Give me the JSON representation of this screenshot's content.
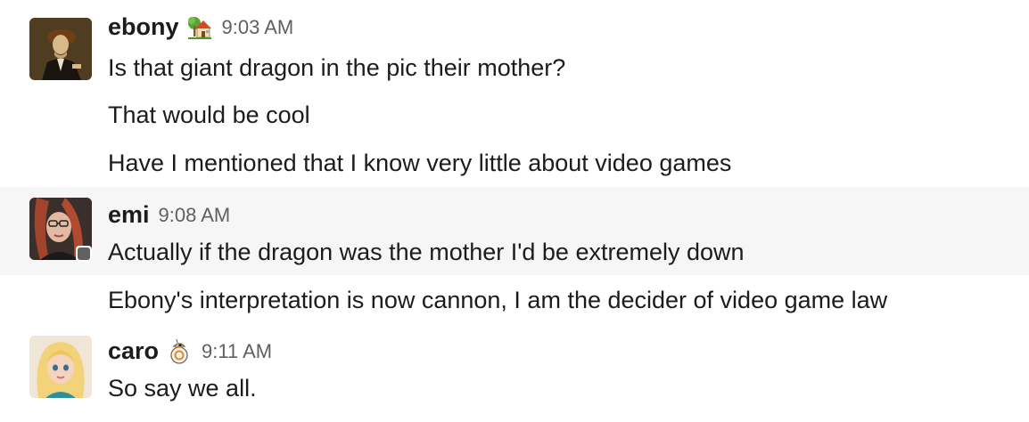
{
  "messages": [
    {
      "username": "ebony",
      "status_emoji": "house-with-garden-icon",
      "time": "9:03 AM",
      "lines": [
        "Is that giant dragon in the pic their mother?",
        "That would be cool",
        "Have I mentioned that I know very little about video games"
      ]
    },
    {
      "username": "emi",
      "time": "9:08 AM",
      "lines": [
        "Actually if the dragon was the mother I'd be extremely down",
        "Ebony's interpretation is now cannon, I am the decider of video game law"
      ]
    },
    {
      "username": "caro",
      "status_emoji": "bb8-droid-icon",
      "time": "9:11 AM",
      "lines": [
        "So say we all."
      ]
    }
  ]
}
